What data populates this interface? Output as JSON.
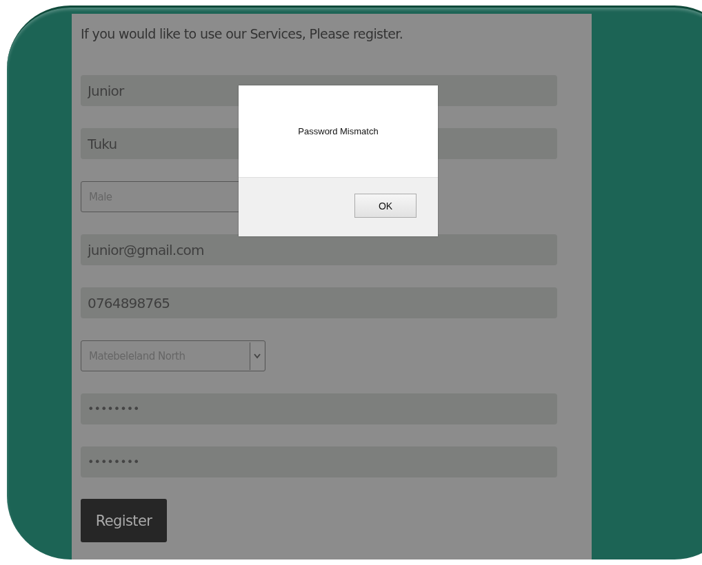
{
  "intro": "If you would like to use our Services, Please register.",
  "fields": [
    {
      "kind": "text",
      "value": "Junior"
    },
    {
      "kind": "text",
      "value": "Tuku"
    },
    {
      "kind": "select",
      "value": "Male"
    },
    {
      "kind": "text",
      "value": "junior@gmail.com"
    },
    {
      "kind": "text",
      "value": "0764898765"
    },
    {
      "kind": "dropdown",
      "value": "Matebeleland North"
    },
    {
      "kind": "password",
      "value": "••••••••"
    },
    {
      "kind": "password",
      "value": "••••••••"
    }
  ],
  "register_button": "Register",
  "dialog": {
    "message": "Password Mismatch",
    "button": "OK"
  }
}
